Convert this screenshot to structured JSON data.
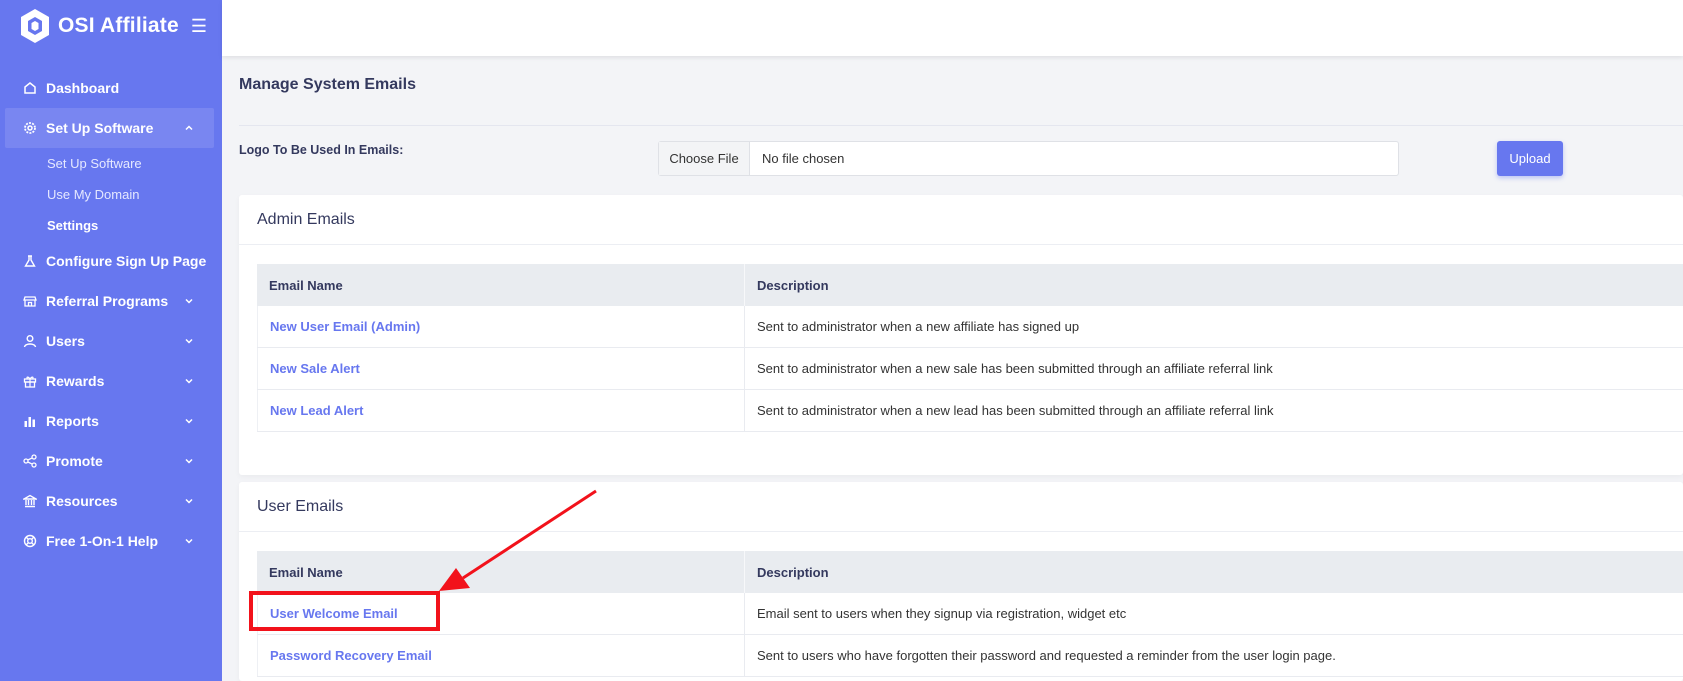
{
  "brand": {
    "name": "OSI Affiliate",
    "logo_icon": "hexagon-logo-icon",
    "menu_icon": "hamburger-icon"
  },
  "sidebar": {
    "items": [
      {
        "label": "Dashboard",
        "icon": "home-icon"
      },
      {
        "label": "Set Up Software",
        "icon": "gear-icon",
        "expanded": true,
        "children": [
          {
            "label": "Set Up Software"
          },
          {
            "label": "Use My Domain"
          },
          {
            "label": "Settings",
            "current": true
          }
        ]
      },
      {
        "label": "Configure Sign Up Page",
        "icon": "flask-icon"
      },
      {
        "label": "Referral Programs",
        "icon": "store-icon"
      },
      {
        "label": "Users",
        "icon": "user-icon"
      },
      {
        "label": "Rewards",
        "icon": "gift-icon"
      },
      {
        "label": "Reports",
        "icon": "bar-chart-icon"
      },
      {
        "label": "Promote",
        "icon": "share-icon"
      },
      {
        "label": "Resources",
        "icon": "bank-icon"
      },
      {
        "label": "Free 1-On-1 Help",
        "icon": "lifebuoy-icon"
      }
    ]
  },
  "main": {
    "title": "Manage System Emails",
    "logo_label": "Logo To Be Used In Emails:",
    "file_button": "Choose File",
    "file_status": "No file chosen",
    "upload_label": "Upload",
    "admin_emails": {
      "title": "Admin Emails",
      "columns": [
        "Email Name",
        "Description"
      ],
      "rows": [
        {
          "name": "New User Email (Admin)",
          "description": "Sent to administrator when a new affiliate has signed up"
        },
        {
          "name": "New Sale Alert",
          "description": "Sent to administrator when a new sale has been submitted through an affiliate referral link"
        },
        {
          "name": "New Lead Alert",
          "description": "Sent to administrator when a new lead has been submitted through an affiliate referral link"
        }
      ]
    },
    "user_emails": {
      "title": "User Emails",
      "columns": [
        "Email Name",
        "Description"
      ],
      "rows": [
        {
          "name": "User Welcome Email",
          "description": "Email sent to users when they signup via registration, widget etc"
        },
        {
          "name": "Password Recovery Email",
          "description": "Sent to users who have forgotten their password and requested a reminder from the user login page."
        }
      ]
    }
  },
  "colors": {
    "sidebar": "#6777ef",
    "accent": "#6777ef",
    "annotation": "#f2121b"
  }
}
